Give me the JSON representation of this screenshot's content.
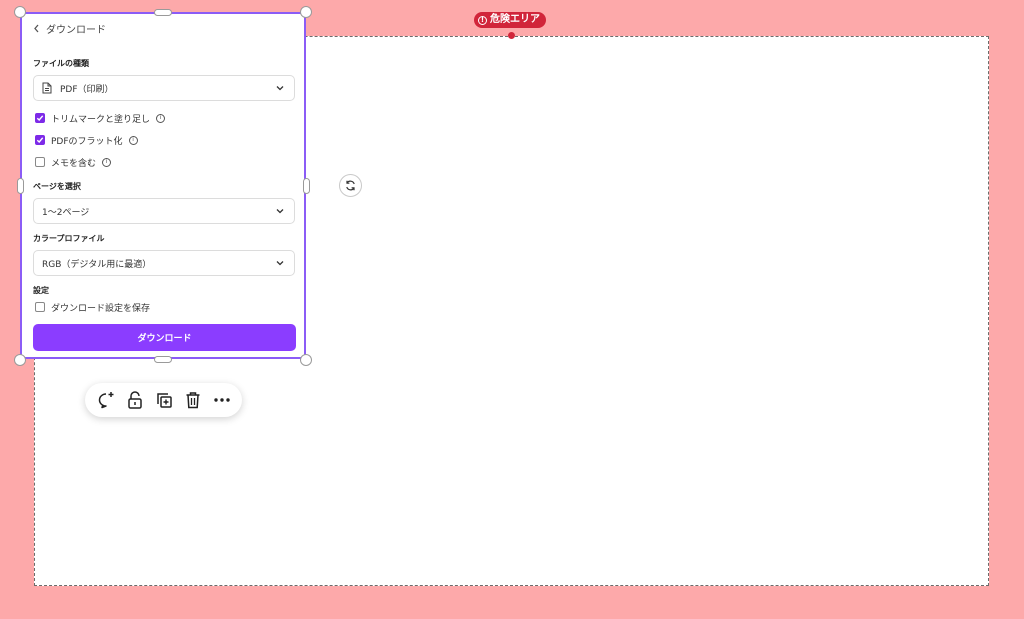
{
  "canvas": {
    "danger_label": "危険エリア"
  },
  "panel": {
    "back_label": "ダウンロード",
    "file_type": {
      "label": "ファイルの種類",
      "value": "PDF（印刷）"
    },
    "options": [
      {
        "label": "トリムマークと塗り足し",
        "checked": true
      },
      {
        "label": "PDFのフラット化",
        "checked": true
      },
      {
        "label": "メモを含む",
        "checked": false
      }
    ],
    "pages": {
      "label": "ページを選択",
      "value": "1〜2ページ"
    },
    "color_profile": {
      "label": "カラープロファイル",
      "value": "RGB（デジタル用に最適）"
    },
    "settings": {
      "label": "設定",
      "save_label": "ダウンロード設定を保存",
      "checked": false
    },
    "download_button": "ダウンロード"
  },
  "toolbar": {
    "icons": [
      "comment-add-icon",
      "unlock-icon",
      "duplicate-icon",
      "trash-icon",
      "more-icon"
    ]
  },
  "colors": {
    "background": "#fda9aa",
    "accent": "#8b3dff",
    "danger": "#d1253a"
  }
}
